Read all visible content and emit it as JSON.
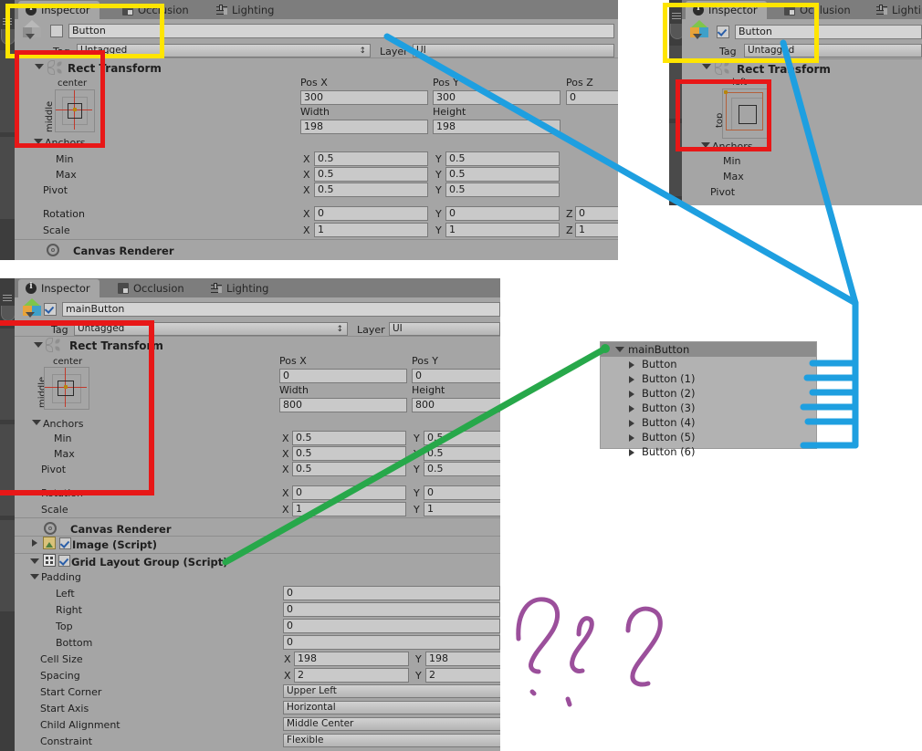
{
  "tabs": [
    {
      "label": "Inspector",
      "icon": "info-icon",
      "active": true
    },
    {
      "label": "Occlusion",
      "icon": "occlusion-icon",
      "active": false
    },
    {
      "label": "Lighting",
      "icon": "lighting-icon",
      "active": false
    }
  ],
  "panel_top_left": {
    "object_name": "Button",
    "enabled": false,
    "tag_label": "Tag",
    "tag_value": "Untagged",
    "layer_label": "Layer",
    "layer_value": "UI",
    "component_title": "Rect Transform",
    "anchor_preset_h": "center",
    "anchor_preset_v": "middle",
    "anchors_label": "Anchors",
    "fields": {
      "pos_x_label": "Pos X",
      "pos_x": "300",
      "pos_y_label": "Pos Y",
      "pos_y": "300",
      "pos_z_label": "Pos Z",
      "pos_z": "0",
      "width_label": "Width",
      "width": "198",
      "height_label": "Height",
      "height": "198",
      "min_label": "Min",
      "min_x": "0.5",
      "min_y": "0.5",
      "max_label": "Max",
      "max_x": "0.5",
      "max_y": "0.5",
      "pivot_label": "Pivot",
      "pivot_x": "0.5",
      "pivot_y": "0.5",
      "rotation_label": "Rotation",
      "rot_x": "0",
      "rot_y": "0",
      "rot_z": "0",
      "scale_label": "Scale",
      "scale_x": "1",
      "scale_y": "1",
      "scale_z": "1"
    },
    "canvas_renderer": "Canvas Renderer"
  },
  "panel_top_right": {
    "object_name": "Button",
    "enabled": true,
    "tag_label": "Tag",
    "tag_value": "Untagged",
    "component_title": "Rect Transform",
    "anchor_preset_h": "left",
    "anchor_preset_v": "top",
    "anchors_label": "Anchors",
    "min_label": "Min",
    "max_label": "Max",
    "pivot_label": "Pivot"
  },
  "panel_bottom_left": {
    "object_name": "mainButton",
    "enabled": true,
    "tag_label": "Tag",
    "tag_value": "Untagged",
    "layer_label": "Layer",
    "layer_value": "UI",
    "component_title": "Rect Transform",
    "anchor_preset_h": "center",
    "anchor_preset_v": "middle",
    "anchors_label": "Anchors",
    "fields": {
      "pos_x_label": "Pos X",
      "pos_x": "0",
      "pos_y_label": "Pos Y",
      "pos_y": "0",
      "width_label": "Width",
      "width": "800",
      "height_label": "Height",
      "height": "800",
      "min_label": "Min",
      "min_x": "0.5",
      "min_y": "0.5",
      "max_label": "Max",
      "max_x": "0.5",
      "max_y": "0.5",
      "pivot_label": "Pivot",
      "pivot_x": "0.5",
      "pivot_y": "0.5",
      "rotation_label": "Rotation",
      "rot_x": "0",
      "rot_y": "0",
      "scale_label": "Scale",
      "scale_x": "1",
      "scale_y": "1"
    },
    "canvas_renderer": "Canvas Renderer",
    "image_component": "Image (Script)",
    "grid_component": "Grid Layout Group (Script)",
    "padding_label": "Padding",
    "grid": {
      "left_label": "Left",
      "left": "0",
      "right_label": "Right",
      "right": "0",
      "top_label": "Top",
      "top": "0",
      "bottom_label": "Bottom",
      "bottom": "0",
      "cell_size_label": "Cell Size",
      "cell_x": "198",
      "cell_y": "198",
      "spacing_label": "Spacing",
      "spacing_x": "2",
      "spacing_y": "2",
      "start_corner_label": "Start Corner",
      "start_corner": "Upper Left",
      "start_axis_label": "Start Axis",
      "start_axis": "Horizontal",
      "child_alignment_label": "Child Alignment",
      "child_alignment": "Middle Center",
      "constraint_label": "Constraint",
      "constraint": "Flexible"
    }
  },
  "hierarchy": {
    "root": "mainButton",
    "children": [
      "Button",
      "Button (1)",
      "Button (2)",
      "Button (3)",
      "Button (4)",
      "Button (5)",
      "Button (6)"
    ]
  },
  "annotations": {
    "question_marks": "???",
    "colors": {
      "highlight_yellow": "#ffe500",
      "highlight_red": "#e81717",
      "arrow_blue": "#1e9fe0",
      "arrow_green": "#27a84a",
      "scribble_purple": "#9b4f9b"
    }
  }
}
